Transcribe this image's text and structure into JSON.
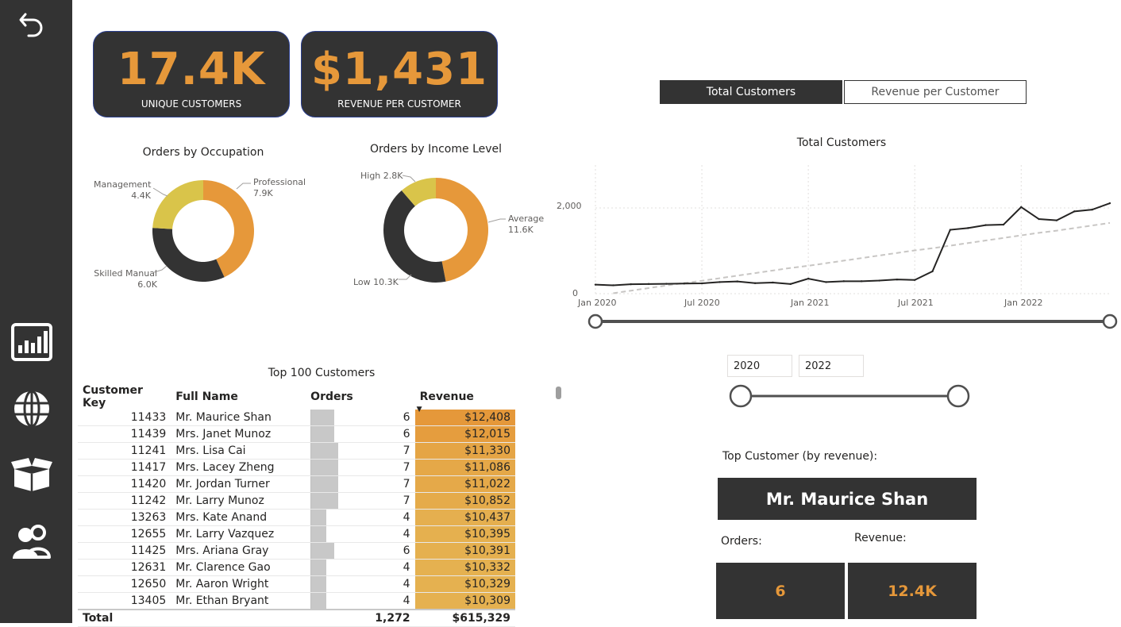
{
  "kpis": [
    {
      "value": "17.4K",
      "label": "UNIQUE CUSTOMERS"
    },
    {
      "value": "$1,431",
      "label": "REVENUE PER CUSTOMER"
    }
  ],
  "sidebar": {
    "items": [
      {
        "icon": "back-arrow-icon"
      },
      {
        "icon": "bar-chart-icon"
      },
      {
        "icon": "globe-icon"
      },
      {
        "icon": "box-icon"
      },
      {
        "icon": "users-icon"
      }
    ]
  },
  "toggle": {
    "active": "Total Customers",
    "inactive": "Revenue per Customer"
  },
  "donut_occupation": {
    "title": "Orders by Occupation",
    "labels": [
      {
        "name": "Professional",
        "value": "7.9K"
      },
      {
        "name": "Management",
        "value": "4.4K"
      },
      {
        "name": "Skilled Manual",
        "value": "6.0K"
      }
    ]
  },
  "donut_income": {
    "title": "Orders by Income Level",
    "labels": [
      {
        "text": "High 2.8K"
      },
      {
        "name": "Average",
        "value": "11.6K"
      },
      {
        "text": "Low 10.3K"
      }
    ]
  },
  "table": {
    "title": "Top 100 Customers",
    "headers": [
      "Customer Key",
      "Full Name",
      "Orders",
      "Revenue"
    ],
    "rows": [
      {
        "key": "11433",
        "name": "Mr. Maurice Shan",
        "orders": "6",
        "revenue": "$12,408"
      },
      {
        "key": "11439",
        "name": "Mrs. Janet Munoz",
        "orders": "6",
        "revenue": "$12,015"
      },
      {
        "key": "11241",
        "name": "Mrs. Lisa Cai",
        "orders": "7",
        "revenue": "$11,330"
      },
      {
        "key": "11417",
        "name": "Mrs. Lacey Zheng",
        "orders": "7",
        "revenue": "$11,086"
      },
      {
        "key": "11420",
        "name": "Mr. Jordan Turner",
        "orders": "7",
        "revenue": "$11,022"
      },
      {
        "key": "11242",
        "name": "Mr. Larry Munoz",
        "orders": "7",
        "revenue": "$10,852"
      },
      {
        "key": "13263",
        "name": "Mrs. Kate Anand",
        "orders": "4",
        "revenue": "$10,437"
      },
      {
        "key": "12655",
        "name": "Mr. Larry Vazquez",
        "orders": "4",
        "revenue": "$10,395"
      },
      {
        "key": "11425",
        "name": "Mrs. Ariana Gray",
        "orders": "6",
        "revenue": "$10,391"
      },
      {
        "key": "12631",
        "name": "Mr. Clarence Gao",
        "orders": "4",
        "revenue": "$10,332"
      },
      {
        "key": "12650",
        "name": "Mr. Aaron Wright",
        "orders": "4",
        "revenue": "$10,329"
      },
      {
        "key": "13405",
        "name": "Mr. Ethan Bryant",
        "orders": "4",
        "revenue": "$10,309"
      }
    ],
    "total": {
      "label": "Total",
      "orders": "1,272",
      "revenue": "$615,329"
    }
  },
  "line_chart_title": "Total Customers",
  "date_range": {
    "start": "2020",
    "end": "2022"
  },
  "top_customer": {
    "label": "Top Customer (by revenue):",
    "name": "Mr. Maurice Shan",
    "orders_label": "Orders:",
    "revenue_label": "Revenue:",
    "orders": "6",
    "revenue": "12.4K"
  },
  "colors": {
    "accent": "#e6983a",
    "dark": "#333333",
    "yellow": "#d9c44a",
    "navy_border": "#2b3f8f"
  },
  "chart_data": [
    {
      "type": "pie",
      "title": "Orders by Occupation",
      "categories": [
        "Professional",
        "Skilled Manual",
        "Management"
      ],
      "values": [
        7.9,
        6.0,
        4.4
      ],
      "unit": "K",
      "colors": [
        "#e6983a",
        "#333333",
        "#d9c44a"
      ]
    },
    {
      "type": "pie",
      "title": "Orders by Income Level",
      "categories": [
        "Average",
        "Low",
        "High"
      ],
      "values": [
        11.6,
        10.3,
        2.8
      ],
      "unit": "K",
      "colors": [
        "#e6983a",
        "#333333",
        "#d9c44a"
      ]
    },
    {
      "type": "line",
      "title": "Total Customers",
      "x": [
        "2020-01",
        "2020-02",
        "2020-03",
        "2020-04",
        "2020-05",
        "2020-06",
        "2020-07",
        "2020-08",
        "2020-09",
        "2020-10",
        "2020-11",
        "2020-12",
        "2021-01",
        "2021-02",
        "2021-03",
        "2021-04",
        "2021-05",
        "2021-06",
        "2021-07",
        "2021-08",
        "2021-09",
        "2021-10",
        "2021-11",
        "2021-12",
        "2022-01",
        "2022-02",
        "2022-03",
        "2022-04",
        "2022-05",
        "2022-06"
      ],
      "series": [
        {
          "values": [
            210,
            195,
            220,
            225,
            230,
            235,
            240,
            270,
            285,
            245,
            260,
            225,
            350,
            270,
            290,
            290,
            305,
            330,
            320,
            520,
            1490,
            1530,
            1600,
            1610,
            2020,
            1740,
            1710,
            1920,
            1960,
            2110
          ]
        },
        {
          "values": [
            -40,
            10,
            70,
            130,
            190,
            250,
            300,
            360,
            420,
            480,
            540,
            600,
            650,
            710,
            770,
            830,
            890,
            950,
            1010,
            1060,
            1120,
            1180,
            1240,
            1300,
            1360,
            1420,
            1470,
            1530,
            1590,
            1650
          ],
          "style": "dashed-trend"
        }
      ],
      "xticks": [
        "Jan 2020",
        "Jul 2020",
        "Jan 2021",
        "Jul 2021",
        "Jan 2022"
      ],
      "yticks": [
        "0",
        "2,000"
      ],
      "ylim": [
        0,
        3000
      ],
      "grid": true
    }
  ]
}
